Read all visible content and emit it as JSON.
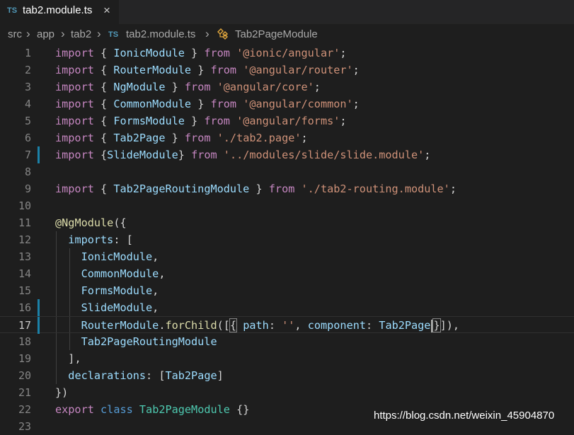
{
  "tab": {
    "badge": "TS",
    "title": "tab2.module.ts",
    "close": "×"
  },
  "breadcrumb": {
    "items": [
      "src",
      "app",
      "tab2",
      "tab2.module.ts",
      "Tab2PageModule"
    ],
    "file_badge": "TS"
  },
  "editor": {
    "line_numbers": [
      "1",
      "2",
      "3",
      "4",
      "5",
      "6",
      "7",
      "8",
      "9",
      "10",
      "11",
      "12",
      "13",
      "14",
      "15",
      "16",
      "17",
      "18",
      "19",
      "20",
      "21",
      "22",
      "23"
    ],
    "current_line": "17",
    "modified_lines": [
      "7",
      "16",
      "17"
    ],
    "colors": {
      "keyword": "#569cd6",
      "control_keyword": "#c586c0",
      "string": "#ce9178",
      "identifier": "#9cdcfe",
      "function": "#dcdcaa",
      "class": "#4ec9b0",
      "gutter_modified": "#1b81a8"
    }
  },
  "code": {
    "l1": {
      "kw": "import",
      "lb": " { ",
      "id": "IonicModule",
      "rb": " } ",
      "from": "from",
      "sp": " ",
      "str": "'@ionic/angular'",
      "end": ";"
    },
    "l2": {
      "kw": "import",
      "lb": " { ",
      "id": "RouterModule",
      "rb": " } ",
      "from": "from",
      "sp": " ",
      "str": "'@angular/router'",
      "end": ";"
    },
    "l3": {
      "kw": "import",
      "lb": " { ",
      "id": "NgModule",
      "rb": " } ",
      "from": "from",
      "sp": " ",
      "str": "'@angular/core'",
      "end": ";"
    },
    "l4": {
      "kw": "import",
      "lb": " { ",
      "id": "CommonModule",
      "rb": " } ",
      "from": "from",
      "sp": " ",
      "str": "'@angular/common'",
      "end": ";"
    },
    "l5": {
      "kw": "import",
      "lb": " { ",
      "id": "FormsModule",
      "rb": " } ",
      "from": "from",
      "sp": " ",
      "str": "'@angular/forms'",
      "end": ";"
    },
    "l6": {
      "kw": "import",
      "lb": " { ",
      "id": "Tab2Page",
      "rb": " } ",
      "from": "from",
      "sp": " ",
      "str": "'./tab2.page'",
      "end": ";"
    },
    "l7": {
      "kw": "import",
      "lb": " {",
      "id": "SlideModule",
      "rb": "} ",
      "from": "from",
      "sp": " ",
      "str": "'../modules/slide/slide.module'",
      "end": ";"
    },
    "l9": {
      "kw": "import",
      "lb": " { ",
      "id": "Tab2PageRoutingModule",
      "rb": " } ",
      "from": "from",
      "sp": " ",
      "str": "'./tab2-routing.module'",
      "end": ";"
    },
    "l11": {
      "at": "@",
      "fn": "NgModule",
      "rest": "({"
    },
    "l12": {
      "indent": "  ",
      "id": "imports",
      "rest": ": ["
    },
    "l13": {
      "indent": "    ",
      "id": "IonicModule",
      "rest": ","
    },
    "l14": {
      "indent": "    ",
      "id": "CommonModule",
      "rest": ","
    },
    "l15": {
      "indent": "    ",
      "id": "FormsModule",
      "rest": ","
    },
    "l16": {
      "indent": "    ",
      "id": "SlideModule",
      "rest": ","
    },
    "l17": {
      "indent": "    ",
      "id": "RouterModule",
      "dot": ".",
      "fn": "forChild",
      "open": "([",
      "brace": "{",
      "sp": " ",
      "path": "path",
      "colon": ": ",
      "str": "''",
      "comma": ", ",
      "comp": "component",
      "colon2": ": ",
      "val": "Tab2Page",
      "sp2": " ",
      "close": "}",
      "rest": "]),"
    },
    "l18": {
      "indent": "    ",
      "id": "Tab2PageRoutingModule"
    },
    "l19": {
      "indent": "  ",
      "rest": "],"
    },
    "l20": {
      "indent": "  ",
      "id": "declarations",
      "rest": ": [",
      "val": "Tab2Page",
      "end": "]"
    },
    "l21": {
      "rest": "})"
    },
    "l22": {
      "kw": "export",
      "sp": " ",
      "kw2": "class",
      "sp2": " ",
      "cls": "Tab2PageModule",
      "rest": " {}"
    }
  },
  "watermark": "https://blog.csdn.net/weixin_45904870"
}
